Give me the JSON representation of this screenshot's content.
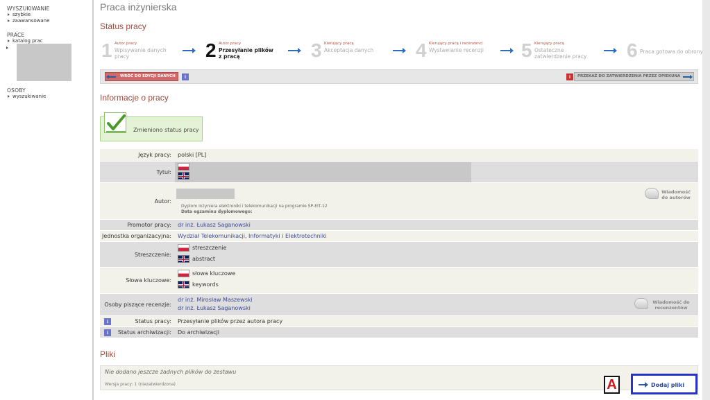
{
  "sidebar": {
    "search_heading": "WYSZUKIWANIE",
    "search_quick": "szybkie",
    "search_advanced": "zaawansowane",
    "works_heading": "PRACE",
    "works_catalog": "katalog prac",
    "people_heading": "OSOBY",
    "people_search": "wyszukiwanie"
  },
  "page": {
    "title": "Praca inżynierska"
  },
  "status": {
    "title": "Status pracy",
    "steps": [
      {
        "number": "1",
        "actor": "Autor pracy",
        "label": "Wpisywanie danych pracy"
      },
      {
        "number": "2",
        "actor": "Autor pracy",
        "label": "Przesyłanie plików z pracą"
      },
      {
        "number": "3",
        "actor": "Kierujący pracą",
        "label": "Akceptacja danych"
      },
      {
        "number": "4",
        "actor": "Kierujący pracą i recenzenci",
        "label": "Wystawianie recenzji"
      },
      {
        "number": "5",
        "actor": "Kierujący pracą",
        "label": "Ostateczne zatwierdzenie pracy"
      },
      {
        "number": "6",
        "actor": "",
        "label": "Praca gotowa do obrony"
      }
    ],
    "back_button": "WRÓĆ DO EDYCJI DANYCH",
    "forward_button": "PRZEKAŻ DO ZATWIERDZENIA PRZEZ OPIEKUNA",
    "info_glyph": "i"
  },
  "info": {
    "title": "Informacje o pracy",
    "notice": "Zmieniono status pracy",
    "language_label": "Język pracy:",
    "language_value": "polski",
    "language_code": "[PL]",
    "title_label": "Tytuł:",
    "author_label": "Autor:",
    "author_program": "Dyplom inżyniera elektroniki i telekomunikacji na programie SP-EIT-12",
    "author_exam": "Data egzaminu dyplomowego:",
    "msg_authors": "Wiadomość do autorów",
    "promotor_label": "Promotor pracy:",
    "promotor_value": "dr inż. Łukasz Saganowski",
    "unit_label": "Jednostka organizacyjna:",
    "unit_value": "Wydział Telekomunikacji, Informatyki i Elektrotechniki",
    "abstract_label": "Streszczenie:",
    "abstract_pl": "streszczenie",
    "abstract_en": "abstract",
    "keywords_label": "Słowa kluczowe:",
    "keywords_pl": "słowa kluczowe",
    "keywords_en": "keywords",
    "reviewers_label": "Osoby piszące recenzje:",
    "reviewer_1": "dr inż. Mirosław Maszewski",
    "reviewer_2": "dr inż. Łukasz Saganowski",
    "msg_reviewers": "Wiadomość do recenzentów",
    "work_status_label": "Status pracy:",
    "work_status_value": "Przesyłanie plików przez autora pracy",
    "archive_status_label": "Status archiwizacji:",
    "archive_status_value": "Do archiwizacji"
  },
  "files": {
    "title": "Pliki",
    "empty": "Nie dodano jeszcze żadnych plików do zestawu",
    "version": "Wersja pracy: 1 (niezatwierdzona)",
    "add_button": "Dodaj pliki",
    "marker": "A"
  },
  "colors": {
    "accent_red": "#a04a3a",
    "link": "#3a4a9a",
    "highlight_box": "#2832c8"
  }
}
